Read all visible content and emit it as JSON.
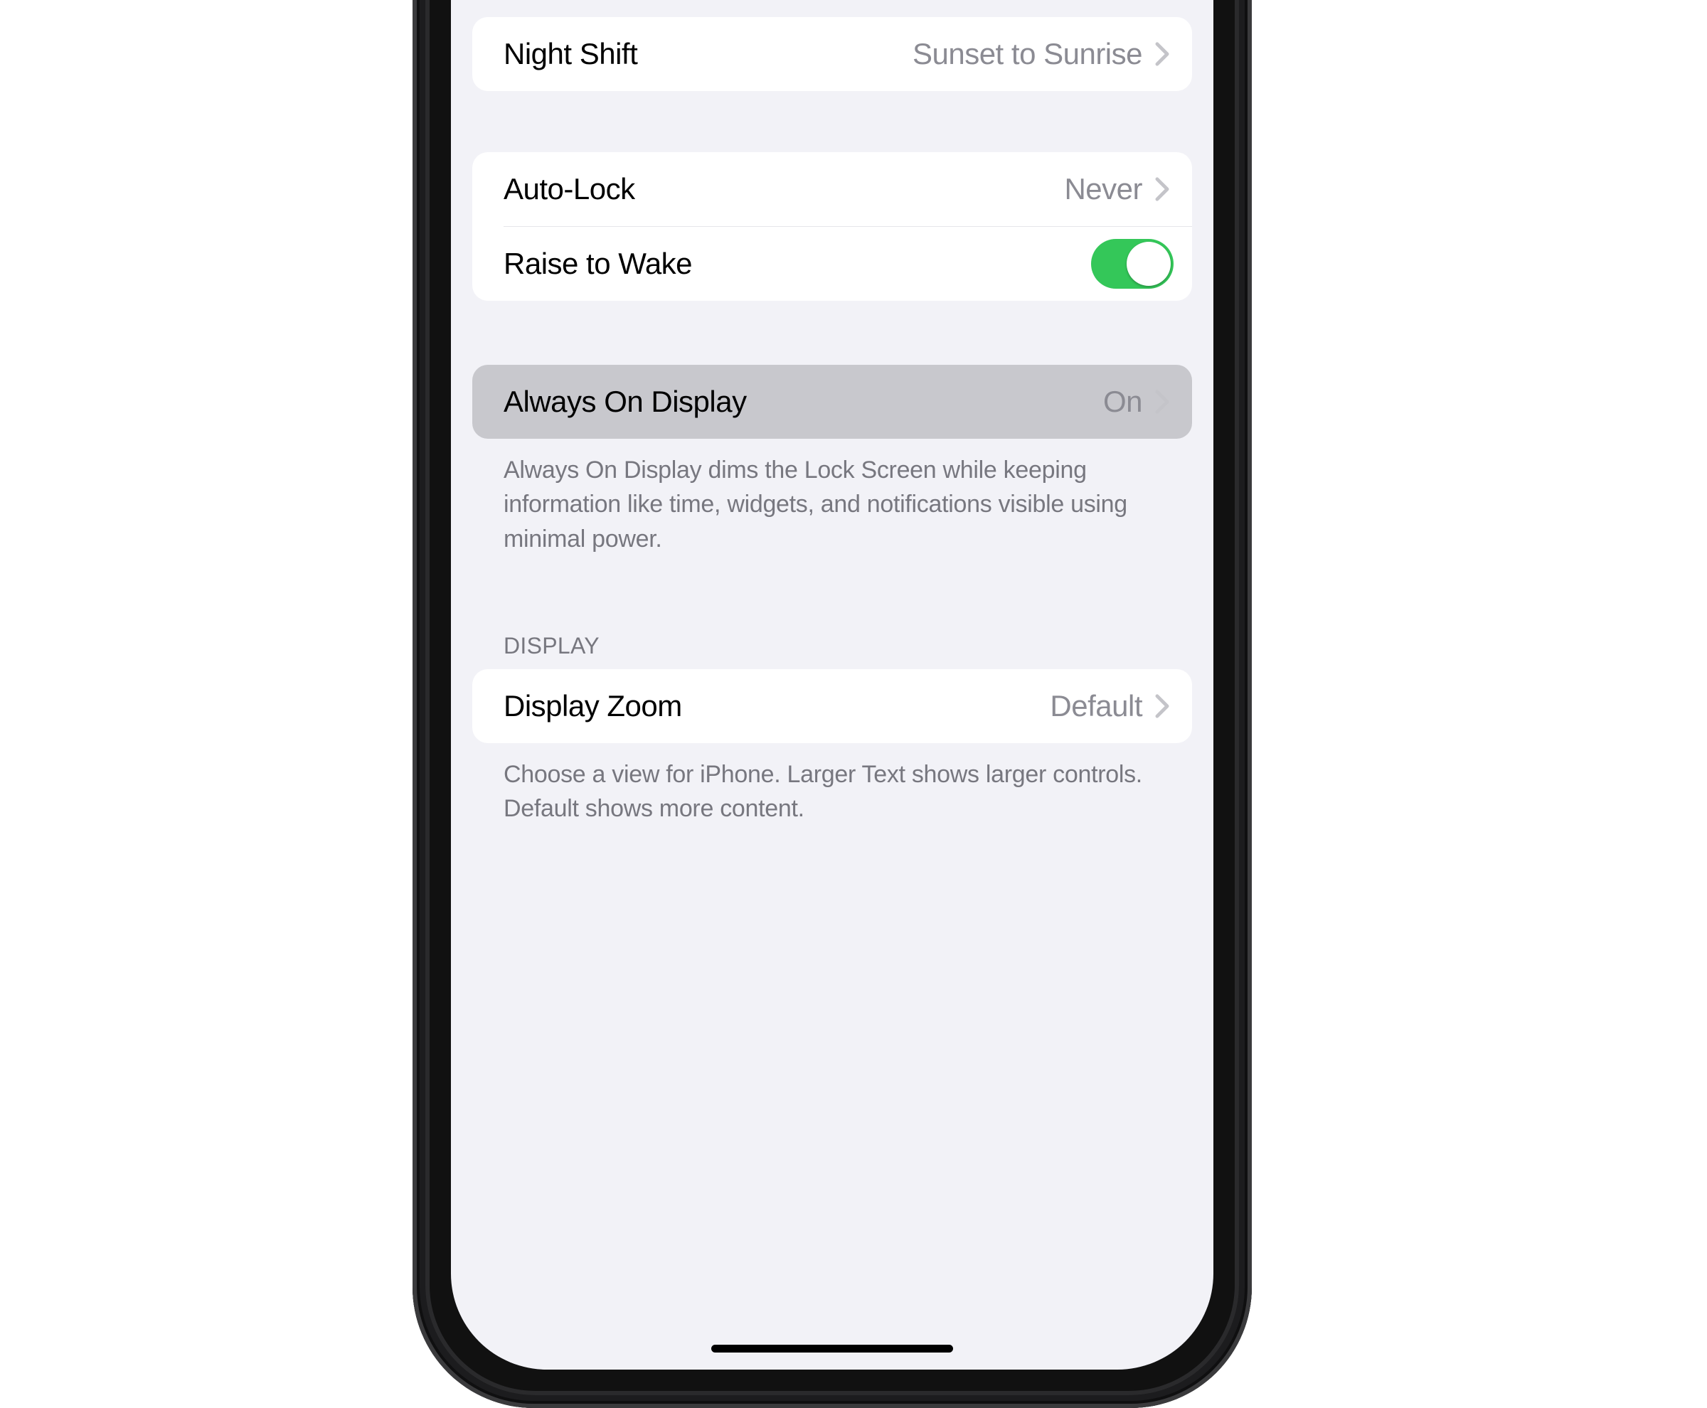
{
  "colors": {
    "bg": "#f2f2f7",
    "card": "#ffffff",
    "highlight": "#c8c8cd",
    "text": "#000000",
    "secondary": "#8b8b93",
    "footer": "#77777f",
    "chevron": "#c4c4c9",
    "toggleOn": "#34c759"
  },
  "groups": {
    "nightShift": {
      "label": "Night Shift",
      "value": "Sunset to Sunrise"
    },
    "lock": {
      "autoLock": {
        "label": "Auto-Lock",
        "value": "Never"
      },
      "raiseToWake": {
        "label": "Raise to Wake",
        "on": true
      }
    },
    "alwaysOn": {
      "label": "Always On Display",
      "value": "On",
      "footer": "Always On Display dims the Lock Screen while keeping information like time, widgets, and notifications visible using minimal power."
    },
    "display": {
      "header": "DISPLAY",
      "zoom": {
        "label": "Display Zoom",
        "value": "Default"
      },
      "footer": "Choose a view for iPhone. Larger Text shows larger controls. Default shows more content."
    }
  }
}
